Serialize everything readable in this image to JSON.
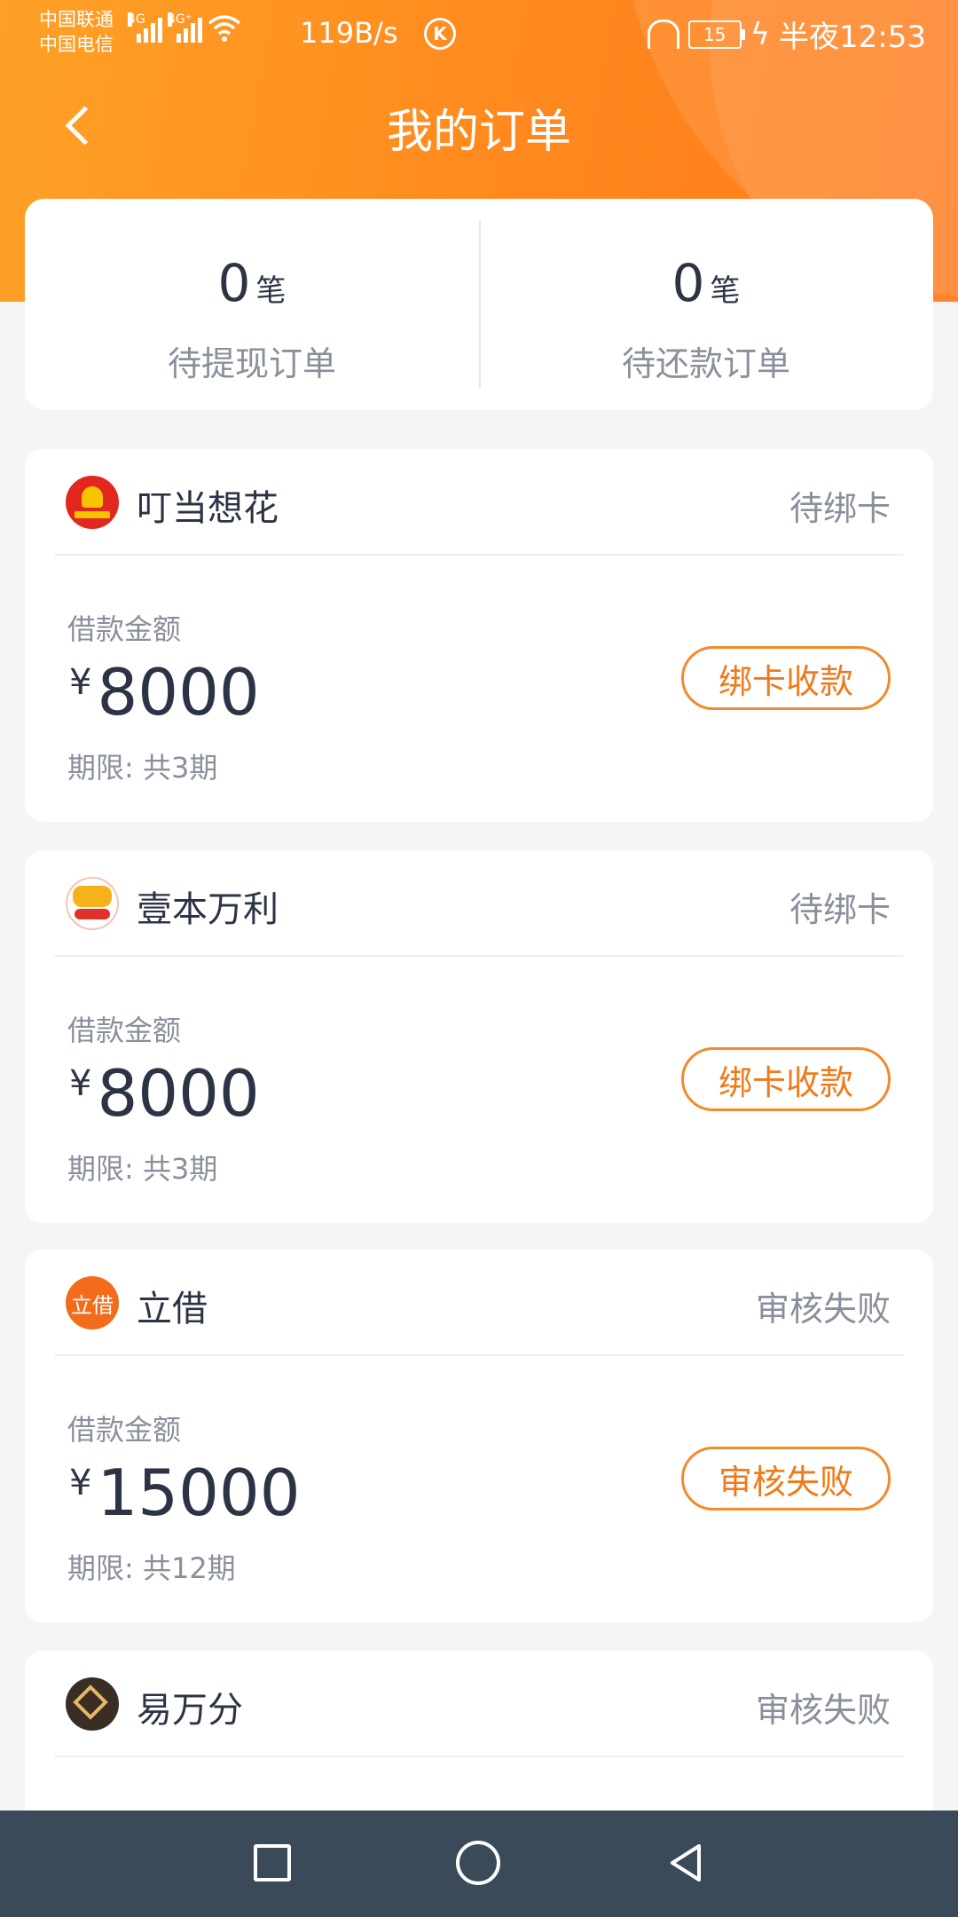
{
  "status_bar": {
    "carrier_1": "中国联通",
    "carrier_2": "中国电信",
    "network_1": "4G",
    "network_2": "4G⁺",
    "speed": "119B/s",
    "k_badge": "K",
    "battery": "15",
    "time": "半夜12:53"
  },
  "header": {
    "title": "我的订单"
  },
  "summary": [
    {
      "count": "0",
      "unit": "笔",
      "label": "待提现订单"
    },
    {
      "count": "0",
      "unit": "笔",
      "label": "待还款订单"
    }
  ],
  "orders": [
    {
      "lender": "叮当想花",
      "status": "待绑卡",
      "amount_label": "借款金额",
      "currency": "¥",
      "amount": "8000",
      "term": "期限: 共3期",
      "action": "绑卡收款"
    },
    {
      "lender": "壹本万利",
      "status": "待绑卡",
      "amount_label": "借款金额",
      "currency": "¥",
      "amount": "8000",
      "term": "期限: 共3期",
      "action": "绑卡收款"
    },
    {
      "lender": "立借",
      "logo_text": "立借",
      "status": "审核失败",
      "amount_label": "借款金额",
      "currency": "¥",
      "amount": "15000",
      "term": "期限: 共12期",
      "action": "审核失败"
    },
    {
      "lender": "易万分",
      "status": "审核失败"
    }
  ],
  "colors": {
    "accent": "#f07a1a",
    "header_start": "#ffa126",
    "header_end": "#ff7a1c",
    "navbar": "#3b4a59"
  }
}
